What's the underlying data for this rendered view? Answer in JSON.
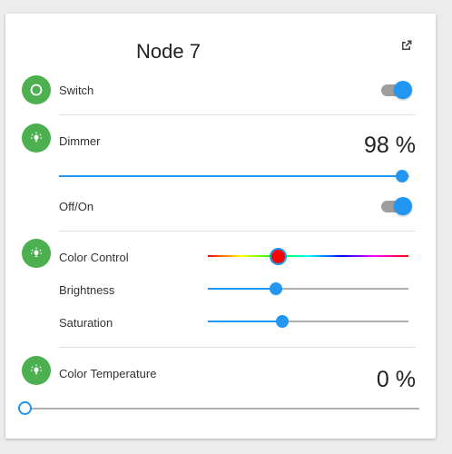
{
  "header": {
    "title": "Node 7",
    "open_icon": "external-link-icon"
  },
  "switch": {
    "label": "Switch",
    "icon": "power-circle-icon",
    "state": "on"
  },
  "dimmer": {
    "label": "Dimmer",
    "icon": "bulb-icon",
    "value_text": "98 %",
    "level": 0.98,
    "toggle_label": "Off/On",
    "toggle_state": "on"
  },
  "color": {
    "icon": "bulb-icon",
    "control_label": "Color Control",
    "color_value": "#ff0000",
    "hue_position": 0.35,
    "brightness_label": "Brightness",
    "brightness_level": 0.34,
    "saturation_label": "Saturation",
    "saturation_level": 0.37
  },
  "temperature": {
    "label": "Color Temperature",
    "icon": "bulb-icon",
    "value_text": "0 %",
    "level": 0.0
  },
  "colors": {
    "accent": "#2196f3",
    "badge": "#4caf50",
    "track_off": "#9e9e9e"
  }
}
